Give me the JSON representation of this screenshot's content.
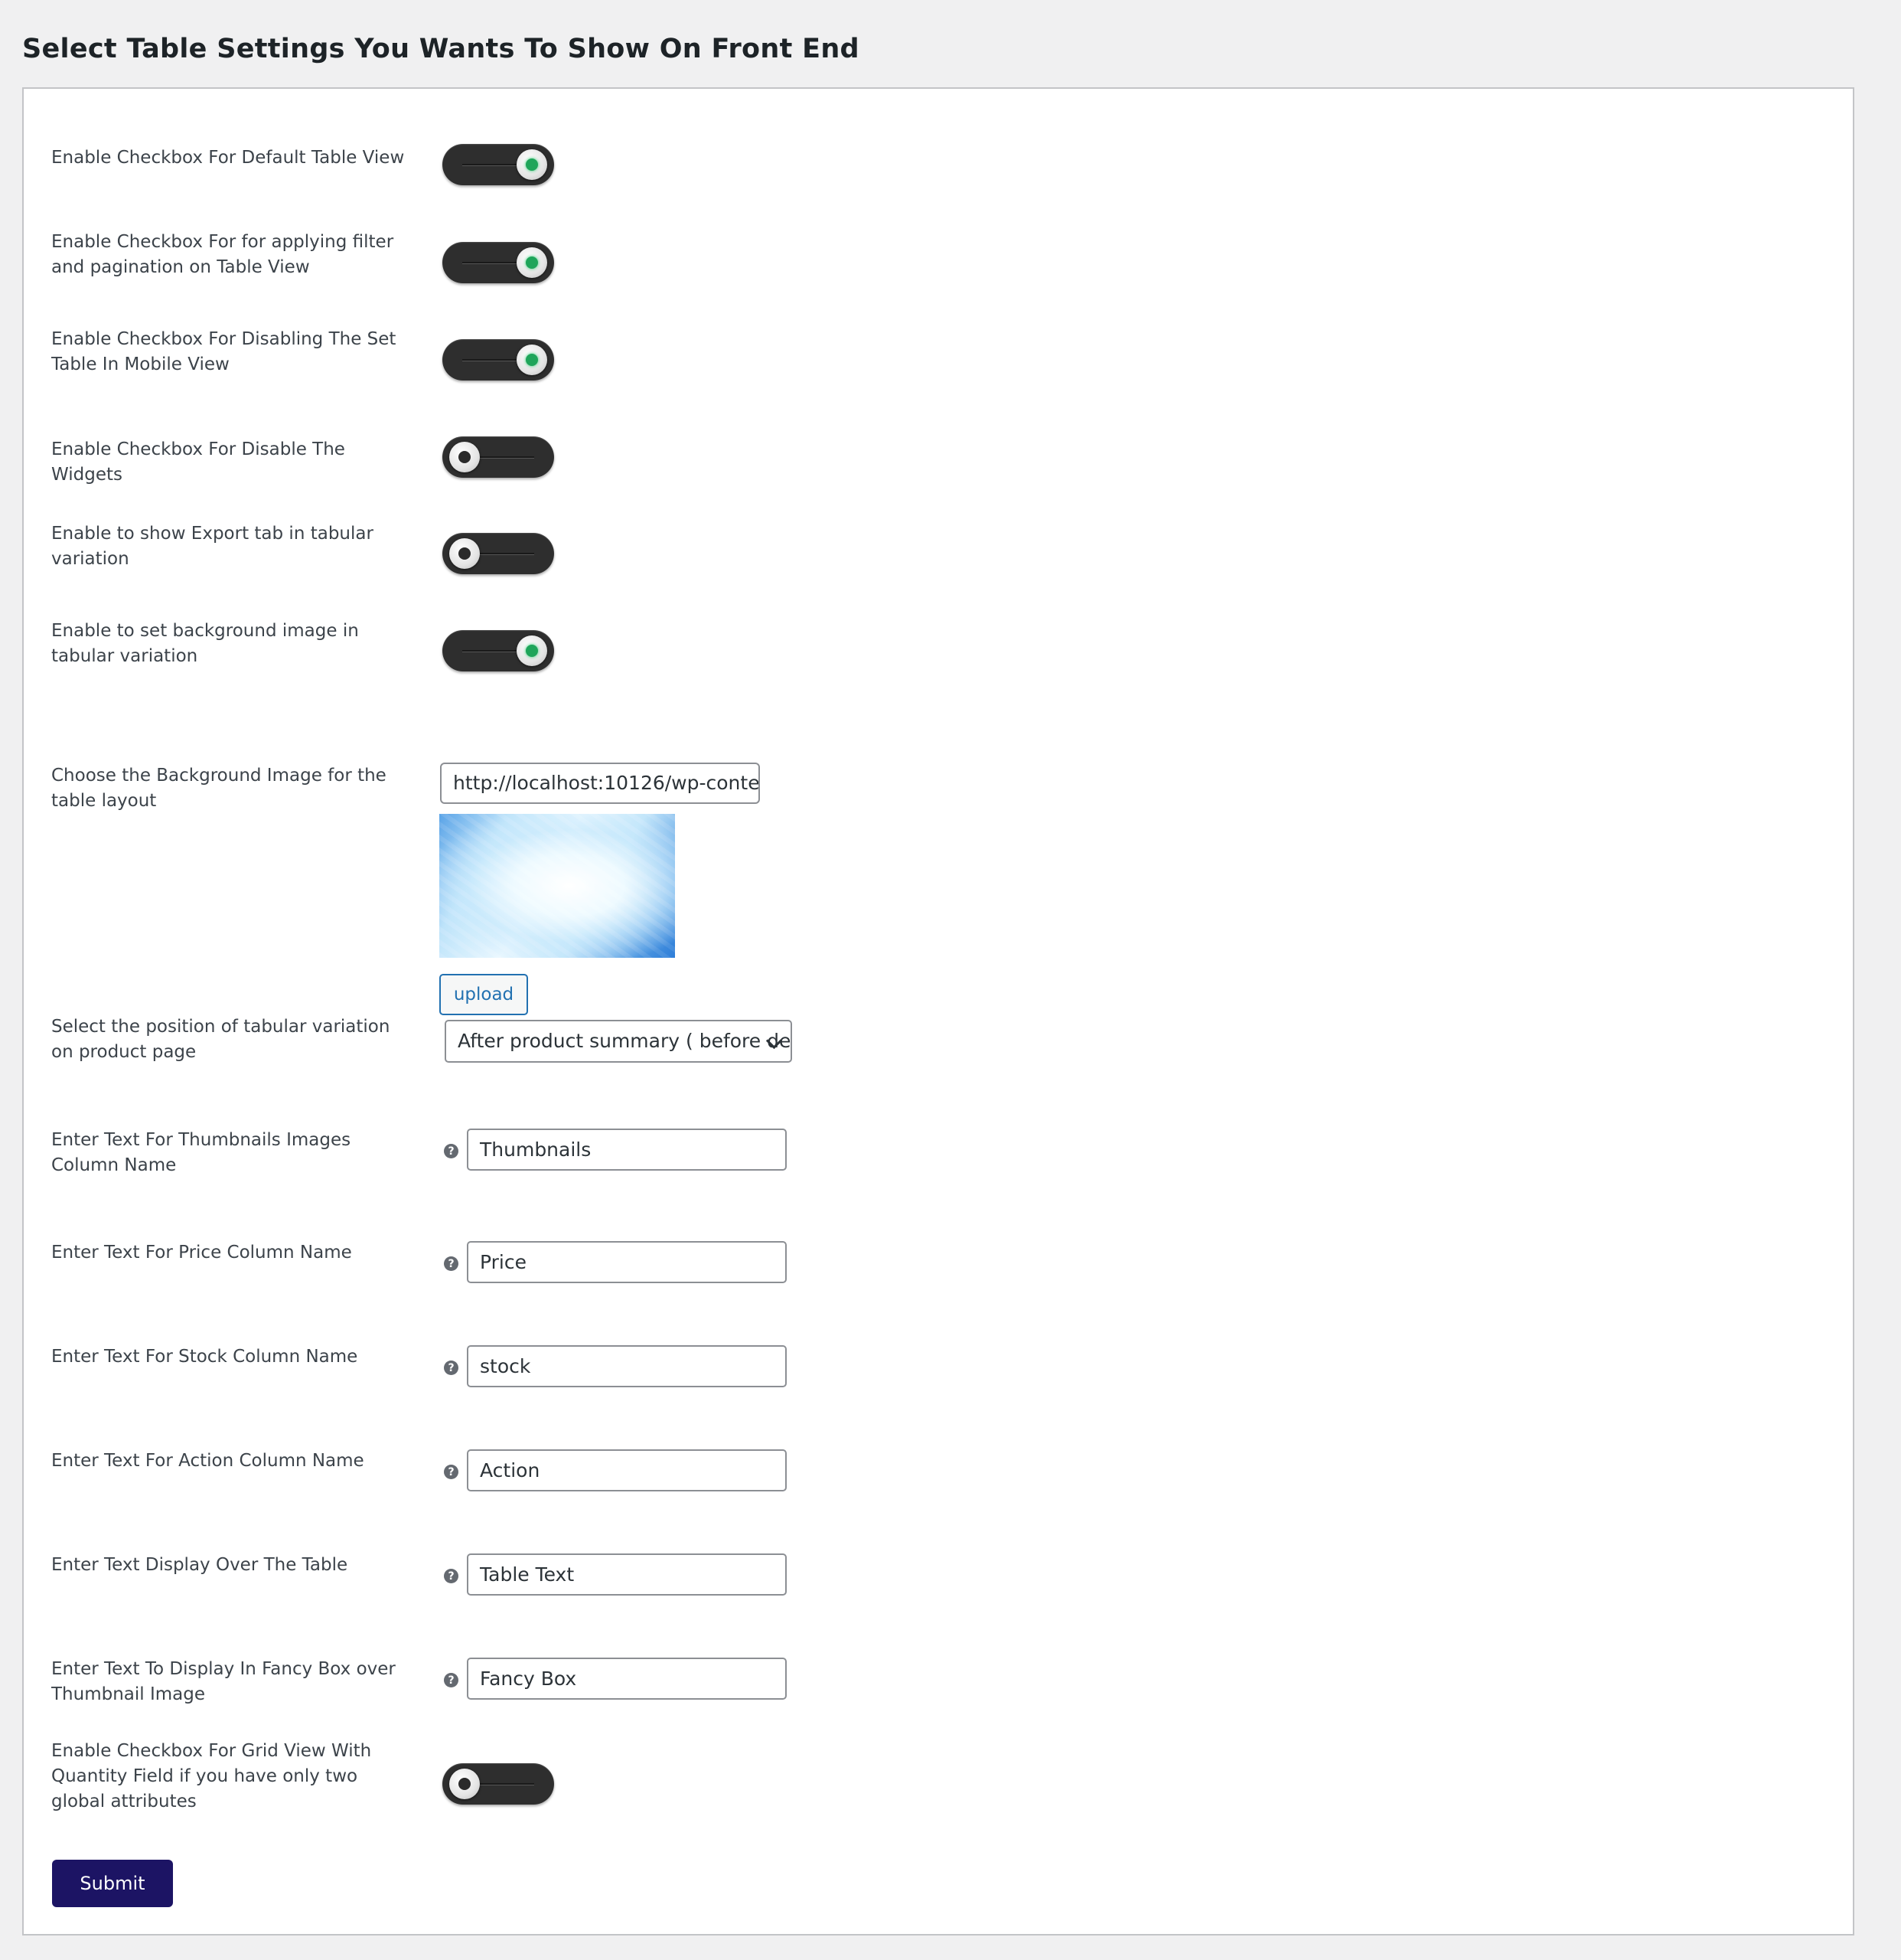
{
  "page": {
    "title": "Select Table Settings You Wants To Show On Front End"
  },
  "toggles": [
    {
      "label": "Enable Checkbox For Default Table View",
      "on": true
    },
    {
      "label": "Enable Checkbox For for applying filter and pagination on Table View",
      "on": true
    },
    {
      "label": "Enable Checkbox For Disabling The Set Table In Mobile View",
      "on": true
    },
    {
      "label": "Enable Checkbox For Disable The Widgets",
      "on": false
    },
    {
      "label": "Enable to show Export tab in tabular variation",
      "on": false
    },
    {
      "label": "Enable to set background image in tabular variation",
      "on": true
    }
  ],
  "background_image": {
    "label": "Choose the Background Image for the table layout",
    "url": "http://localhost:10126/wp-conter",
    "upload_label": "upload"
  },
  "position": {
    "label": "Select the position of tabular variation on product page",
    "selected": "After product summary ( before de"
  },
  "text_fields": [
    {
      "label": "Enter Text For Thumbnails Images Column Name",
      "value": "Thumbnails"
    },
    {
      "label": "Enter Text For Price Column Name",
      "value": "Price"
    },
    {
      "label": "Enter Text For Stock Column Name",
      "value": "stock"
    },
    {
      "label": "Enter Text For Action Column Name",
      "value": "Action"
    },
    {
      "label": "Enter Text Display Over The Table",
      "value": "Table Text"
    },
    {
      "label": "Enter Text To Display In Fancy Box over Thumbnail Image",
      "value": "Fancy Box"
    }
  ],
  "help_icon_glyph": "?",
  "grid_toggle": {
    "label": "Enable Checkbox For Grid View With Quantity Field if you have only two global attributes",
    "on": false
  },
  "submit_label": "Submit"
}
